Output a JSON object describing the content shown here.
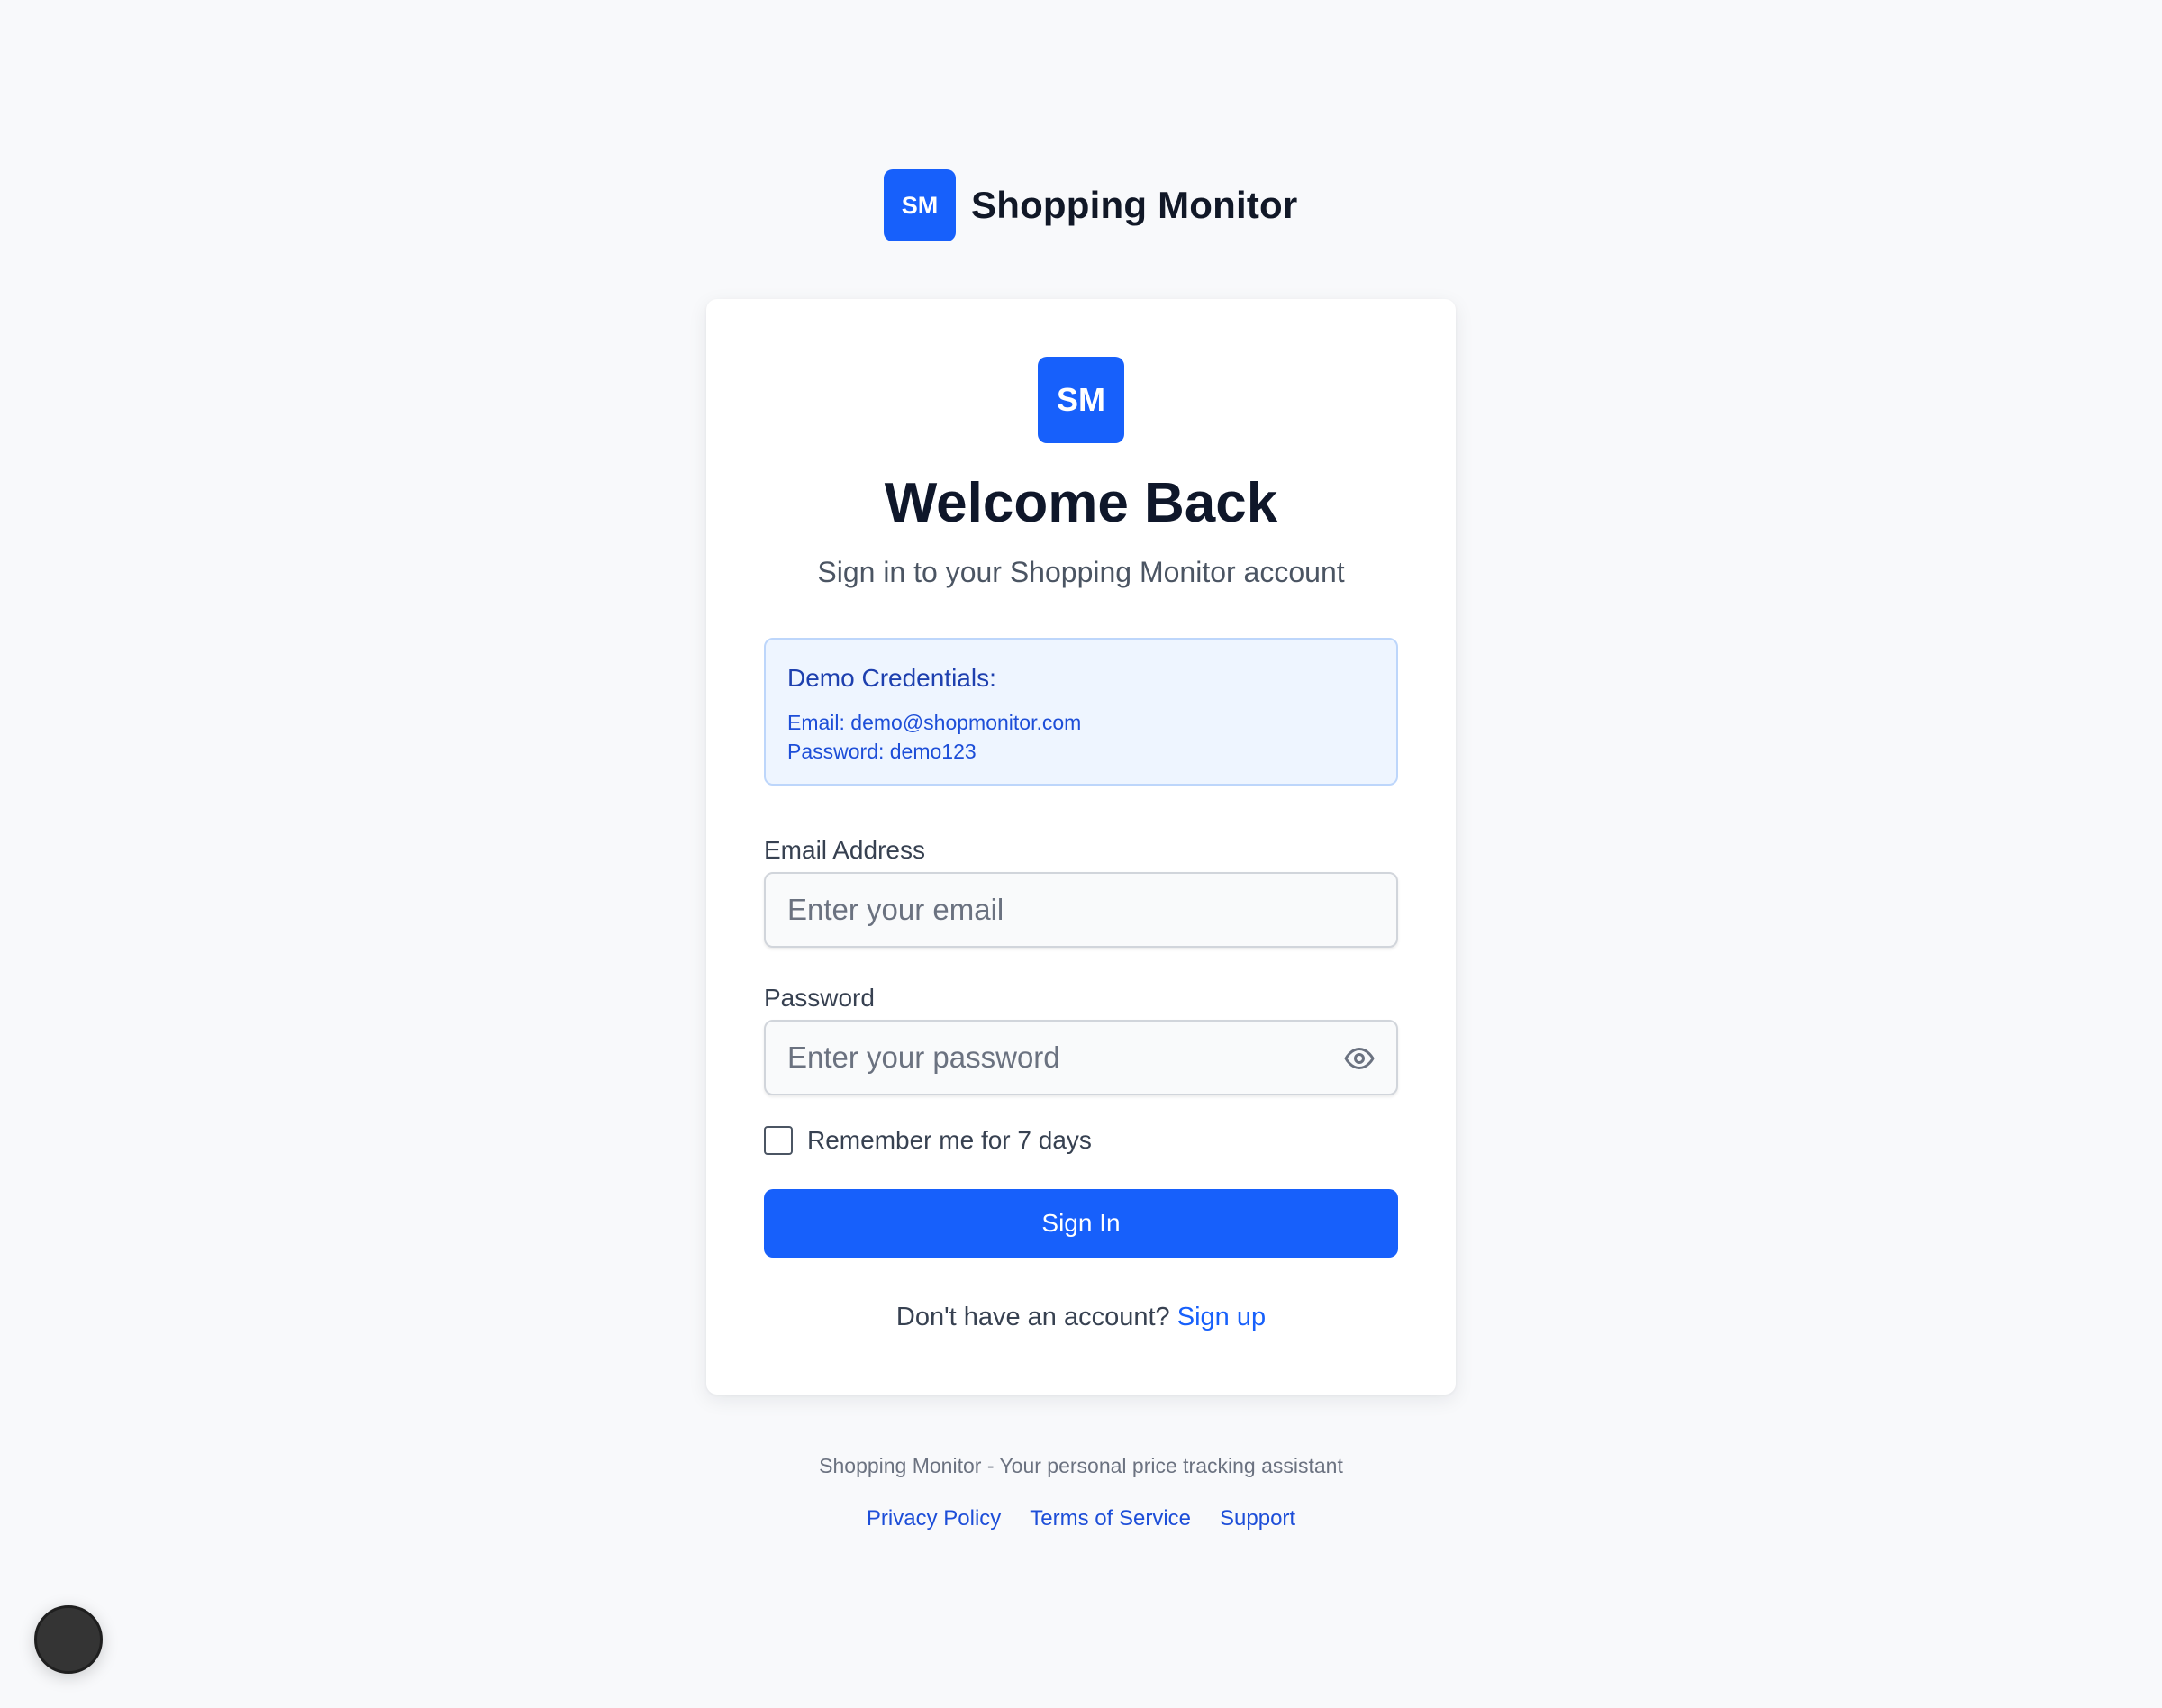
{
  "brand": {
    "logo_text": "SM",
    "name": "Shopping Monitor",
    "accent_color": "#1760fb"
  },
  "card": {
    "logo_text": "SM",
    "title": "Welcome Back",
    "subtitle": "Sign in to your Shopping Monitor account",
    "demo": {
      "title": "Demo Credentials:",
      "email_line": "Email: demo@shopmonitor.com",
      "password_line": "Password: demo123"
    },
    "email": {
      "label": "Email Address",
      "value": "",
      "placeholder": "Enter your email"
    },
    "password": {
      "label": "Password",
      "value": "",
      "placeholder": "Enter your password",
      "toggle_icon": "eye-icon"
    },
    "remember": {
      "label": "Remember me for 7 days",
      "checked": false
    },
    "signin_label": "Sign In",
    "signup_prompt": "Don't have an account?",
    "signup_link": "Sign up"
  },
  "footer": {
    "tagline": "Shopping Monitor - Your personal price tracking assistant",
    "links": [
      "Privacy Policy",
      "Terms of Service",
      "Support"
    ]
  }
}
